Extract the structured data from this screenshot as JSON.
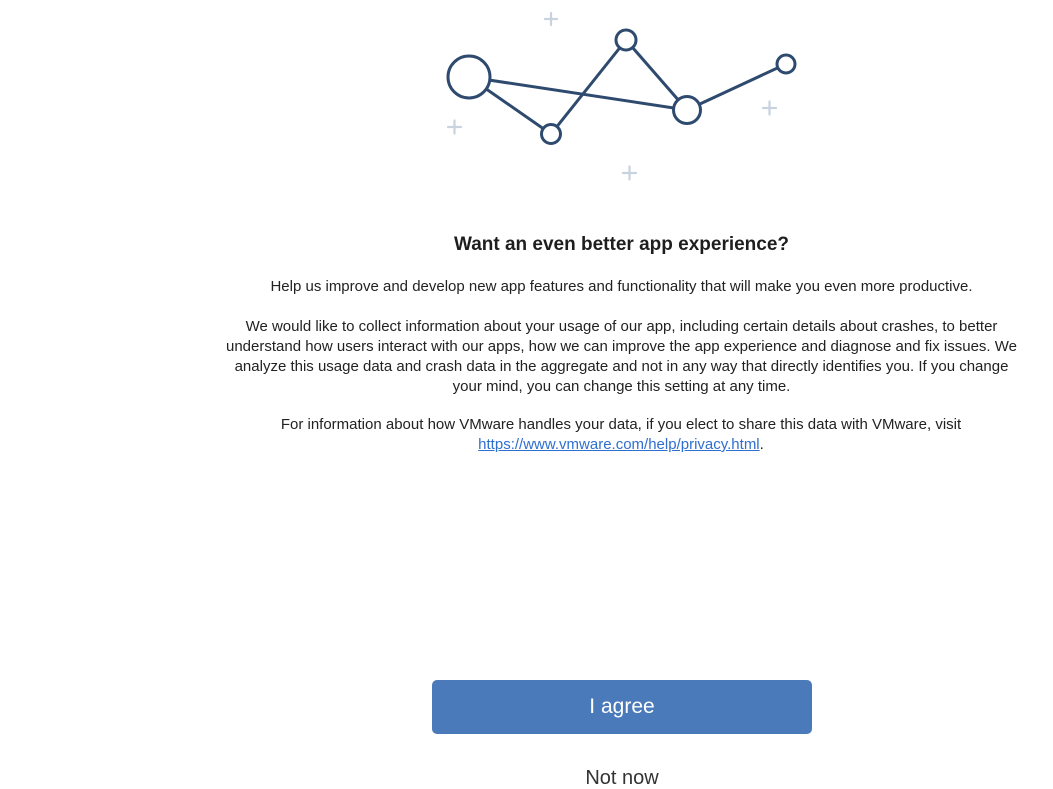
{
  "dialog": {
    "title": "Want an even better app experience?",
    "intro": "Help us improve and develop new app features and functionality that will make you even more productive.",
    "usage_text": "We would like to collect information about your usage of our app, including certain details about crashes, to better\nunderstand how users interact with our apps, how we can improve the app experience and diagnose and fix issues. We\nanalyze this usage data and crash data in the aggregate and not in any way that directly identifies you. If you change\nyour mind, you can change this setting at any time.",
    "privacy_prefix": "For information about how VMware handles your data, if you elect to share this data with VMware, visit ",
    "privacy_link": "https://www.vmware.com/help/privacy.html",
    "privacy_suffix": "."
  },
  "buttons": {
    "agree_label": "I agree",
    "not_now_label": "Not now"
  },
  "illustration": {
    "icon": "network-graph-icon",
    "stroke_color": "#2e4a6e",
    "sparkle_color": "#c9d3e0"
  },
  "colors": {
    "primary_button": "#4a7aba",
    "link": "#2f6fcf"
  }
}
